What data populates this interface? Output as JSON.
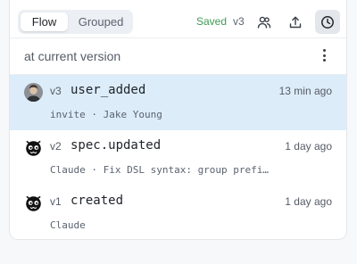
{
  "toolbar": {
    "tabs": [
      {
        "label": "Flow",
        "active": true
      },
      {
        "label": "Grouped",
        "active": false
      }
    ],
    "saved_label": "Saved",
    "version_label": "v3",
    "icons": [
      "users-icon",
      "upload-icon",
      "history-clock-icon"
    ]
  },
  "subheader": {
    "text": "at current version"
  },
  "events": [
    {
      "version": "v3",
      "event": "user_added",
      "time": "13 min ago",
      "meta": "invite · Jake Young",
      "avatar": "user-photo",
      "selected": true
    },
    {
      "version": "v2",
      "event": "spec.updated",
      "time": "1 day ago",
      "meta": "Claude · Fix DSL syntax: group prefi…",
      "avatar": "claude-bot",
      "selected": false
    },
    {
      "version": "v1",
      "event": "created",
      "time": "1 day ago",
      "meta": "Claude",
      "avatar": "claude-bot",
      "selected": false
    }
  ],
  "colors": {
    "saved": "#3f9a55",
    "selected_row": "#dcecf9"
  }
}
